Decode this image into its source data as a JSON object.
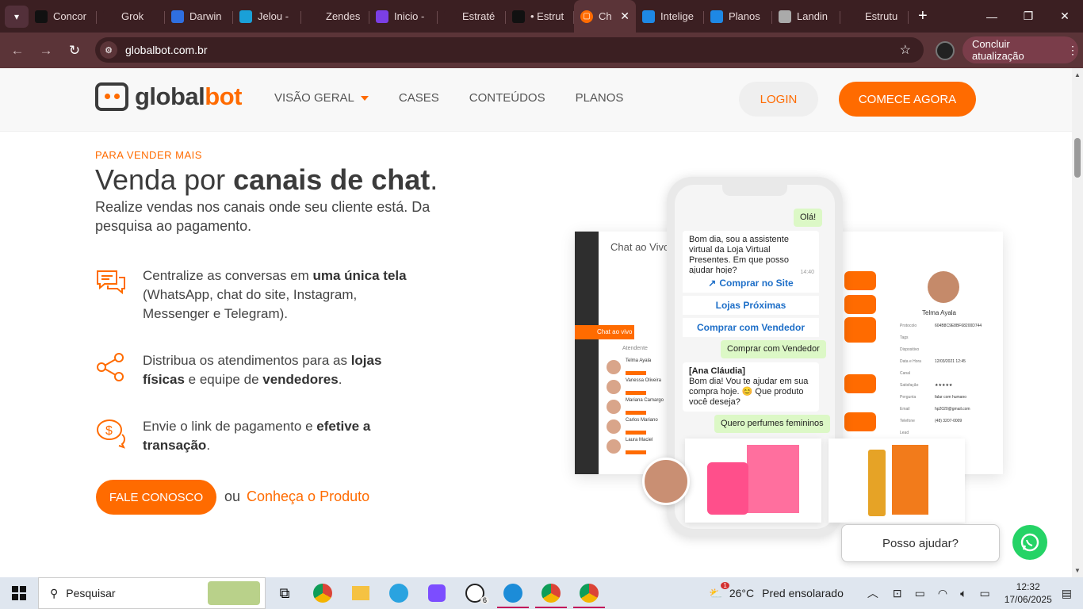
{
  "browser": {
    "tabs": [
      {
        "label": "Concor",
        "icon": "notion-icon",
        "color": "#111111"
      },
      {
        "label": "Grok",
        "icon": "grok-icon",
        "color": "#3b1f22"
      },
      {
        "label": "Darwin",
        "icon": "darwin-icon",
        "color": "#2f6fe0"
      },
      {
        "label": "Jelou -",
        "icon": "jelou-icon",
        "color": "#1aa0d8"
      },
      {
        "label": "Zendes",
        "icon": "zendesk-icon",
        "color": "#3b1f22"
      },
      {
        "label": "Inicio -",
        "icon": "inicio-icon",
        "color": "#7b3fe4"
      },
      {
        "label": "Estraté",
        "icon": "chatgpt-icon",
        "color": "#3b1f22"
      },
      {
        "label": "• Estrut",
        "icon": "notion-icon",
        "color": "#111111"
      }
    ],
    "active_tab": {
      "label": "Ch",
      "icon": "globalbot-icon",
      "close": "✕"
    },
    "tabs_right": [
      {
        "label": "Intelige",
        "icon": "chat-icon",
        "color": "#1e88e5"
      },
      {
        "label": "Planos",
        "icon": "chat-icon",
        "color": "#1e88e5"
      },
      {
        "label": "Landin",
        "icon": "landing-icon",
        "color": "#aaaaaa"
      },
      {
        "label": "Estrutu",
        "icon": "chatgpt-icon",
        "color": "#3b1f22"
      }
    ],
    "new_tab": "+",
    "url": "globalbot.com.br",
    "update_label": "Concluir atualização",
    "update_dots": "⋮"
  },
  "site": {
    "logo_text_a": "global",
    "logo_text_b": "bot",
    "menu": [
      "VISÃO GERAL",
      "CASES",
      "CONTEÚDOS",
      "PLANOS"
    ],
    "login": "LOGIN",
    "start": "COMECE AGORA",
    "eyebrow": "PARA VENDER MAIS",
    "headline_a": "Venda por ",
    "headline_b": "canais de chat",
    "headline_c": ".",
    "sub": "Realize vendas nos canais onde seu cliente está. Da pesquisa ao pagamento.",
    "features": [
      {
        "a": "Centralize as conversas em ",
        "b": "uma única tela",
        "c": " (WhatsApp, chat do site, Instagram, Messenger e Telegram)."
      },
      {
        "a": "Distribua os atendimentos para as ",
        "b": "lojas físicas",
        "c": " e equipe de ",
        "d": "vendedores",
        "e": "."
      },
      {
        "a": "Envie o link de pagamento e ",
        "b": "efetive a transação",
        "c": "."
      }
    ],
    "contact": "FALE CONOSCO",
    "ou": "ou",
    "product_link": "Conheça o Produto"
  },
  "illustration": {
    "dash_title": "Chat ao Vivo",
    "live_label": "Chat ao vivo",
    "atendente": "Atendente",
    "contacts": [
      {
        "name": "Telma Ayala",
        "tag": "COMERCIAL"
      },
      {
        "name": "Vanessa Oliveira",
        "tag": "SUPORTE"
      },
      {
        "name": "Mariana Camargo",
        "tag": "FINANCEIRO"
      },
      {
        "name": "Carlos Mariano",
        "tag": "SUPORTE"
      },
      {
        "name": "Laura Maciel",
        "tag": "COMERCIAL"
      }
    ],
    "profile_name": "Telma Ayala",
    "profile_fields": [
      {
        "k": "Protocolo",
        "v": "604B8C9E8BF68200D744"
      },
      {
        "k": "Tags",
        "v": ""
      },
      {
        "k": "Dispositivo",
        "v": ""
      },
      {
        "k": "Data e Hora",
        "v": "12/03/2021 12:45"
      },
      {
        "k": "Canal",
        "v": ""
      },
      {
        "k": "Satisfação",
        "v": "★★★★★"
      },
      {
        "k": "Pergunta",
        "v": "falar com humano"
      },
      {
        "k": "Email",
        "v": "hp2020@gmail.com"
      },
      {
        "k": "Telefone",
        "v": "(48) 3207-0009"
      },
      {
        "k": "Lead",
        "v": ""
      }
    ],
    "chat": {
      "hello": "Olá!",
      "bot_msg": "Bom dia, sou a assistente virtual da Loja Virtual Presentes. Em que posso ajudar hoje?",
      "bot_time": "14:40",
      "opt1": "Comprar no Site",
      "opt2": "Lojas Próximas",
      "opt3": "Comprar com Vendedor",
      "user_choice": "Comprar com Vendedor",
      "agent_name": "[Ana Cláudia]",
      "agent_msg": "Bom dia! Vou te ajudar em sua compra hoje. 😊 Que produto você deseja?",
      "user_msg": "Quero perfumes femininos"
    },
    "help_label": "Posso ajudar?"
  },
  "taskbar": {
    "search_placeholder": "Pesquisar",
    "weather_temp": "26°C",
    "weather_text": "Pred ensolarado",
    "weather_badge": "1",
    "whatsapp_badge": "6",
    "time": "12:32",
    "date": "17/06/2025"
  }
}
